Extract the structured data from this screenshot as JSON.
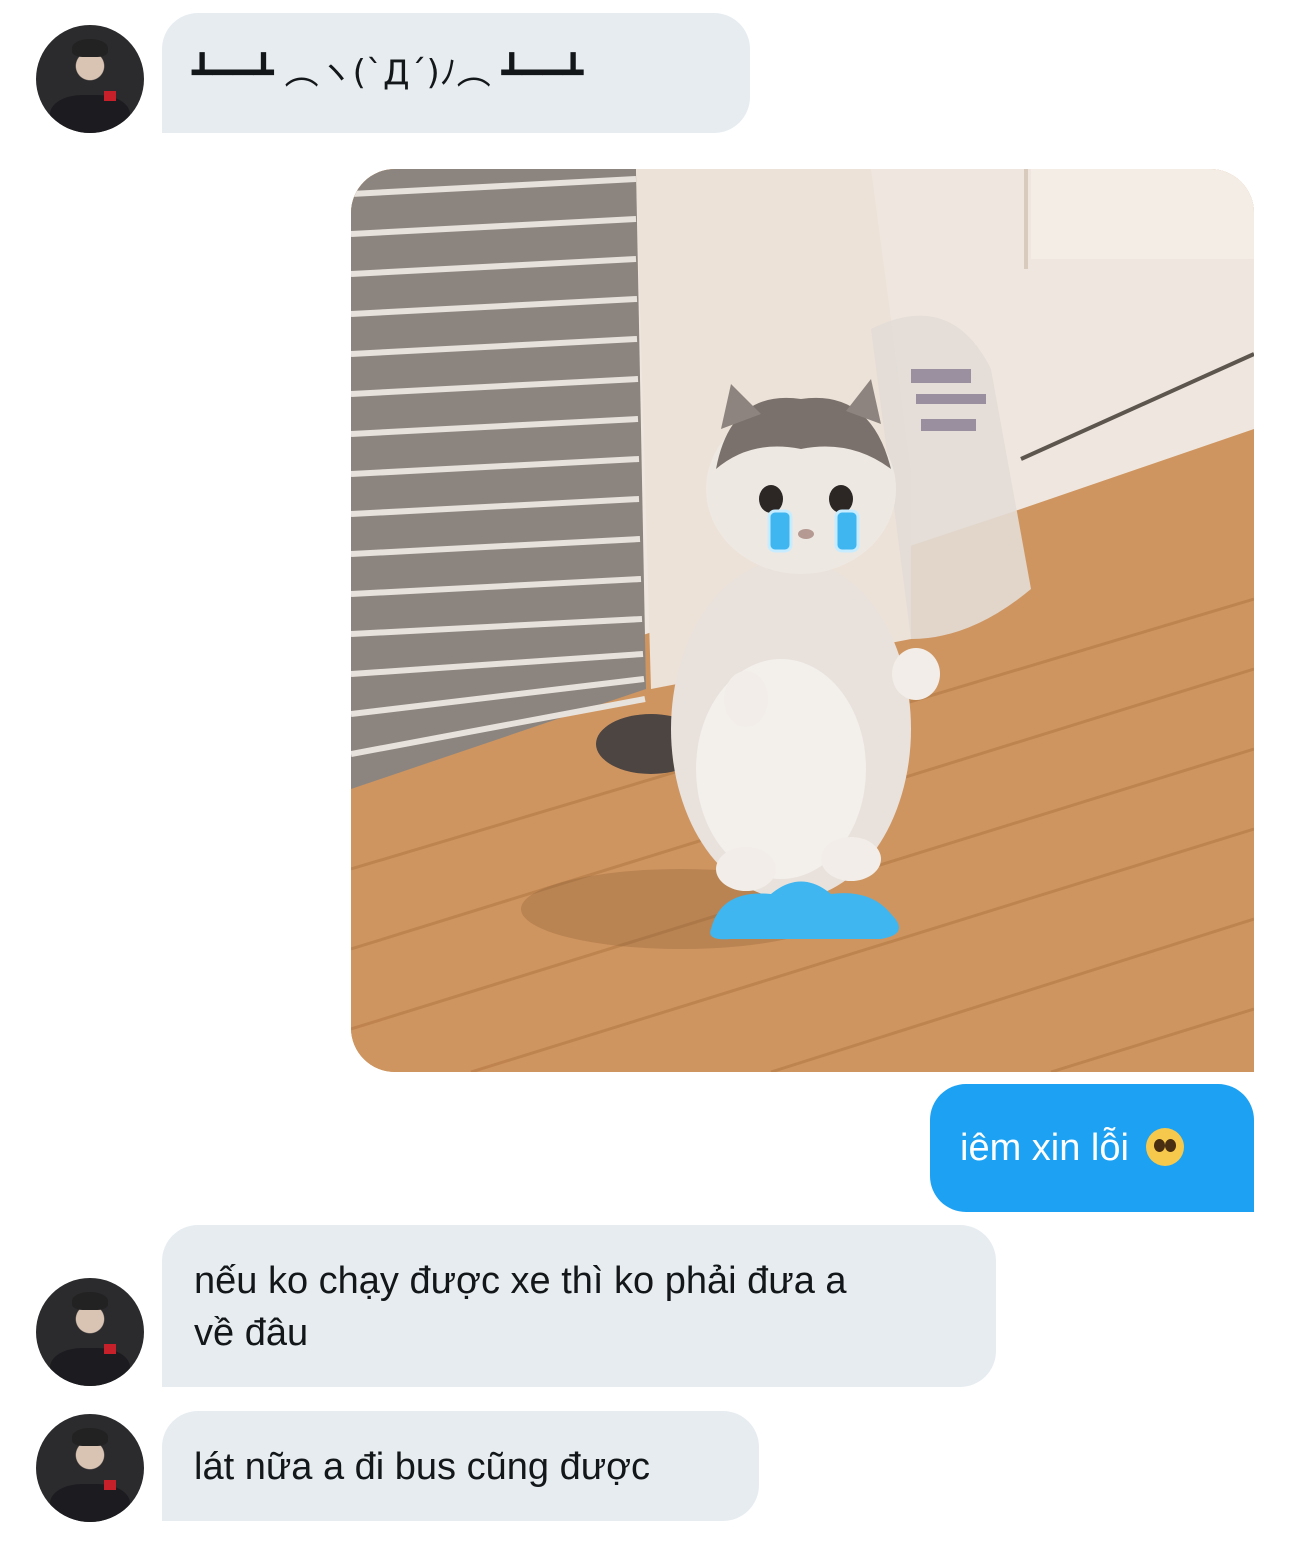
{
  "messages": [
    {
      "from": "them",
      "text": "┻━━┻ ︵ヽ(`Д´)ﾉ︵ ┻━━┻"
    },
    {
      "from": "me",
      "type": "image",
      "icon": "crying-cat-meme-image"
    },
    {
      "from": "me",
      "text": "iêm xin lỗi",
      "emoji": "pleading-face-icon"
    },
    {
      "from": "them",
      "text_line1": "nếu ko chạy được xe thì ko phải đưa a",
      "text_line2": "về đâu"
    },
    {
      "from": "them",
      "text": "lát nữa a đi bus cũng được"
    }
  ],
  "colors": {
    "incoming_bubble": "#e6ecf0",
    "outgoing_bubble": "#1da1f2",
    "incoming_text": "#14171a",
    "outgoing_text": "#ffffff",
    "tear_blue": "#3fb6f0"
  }
}
